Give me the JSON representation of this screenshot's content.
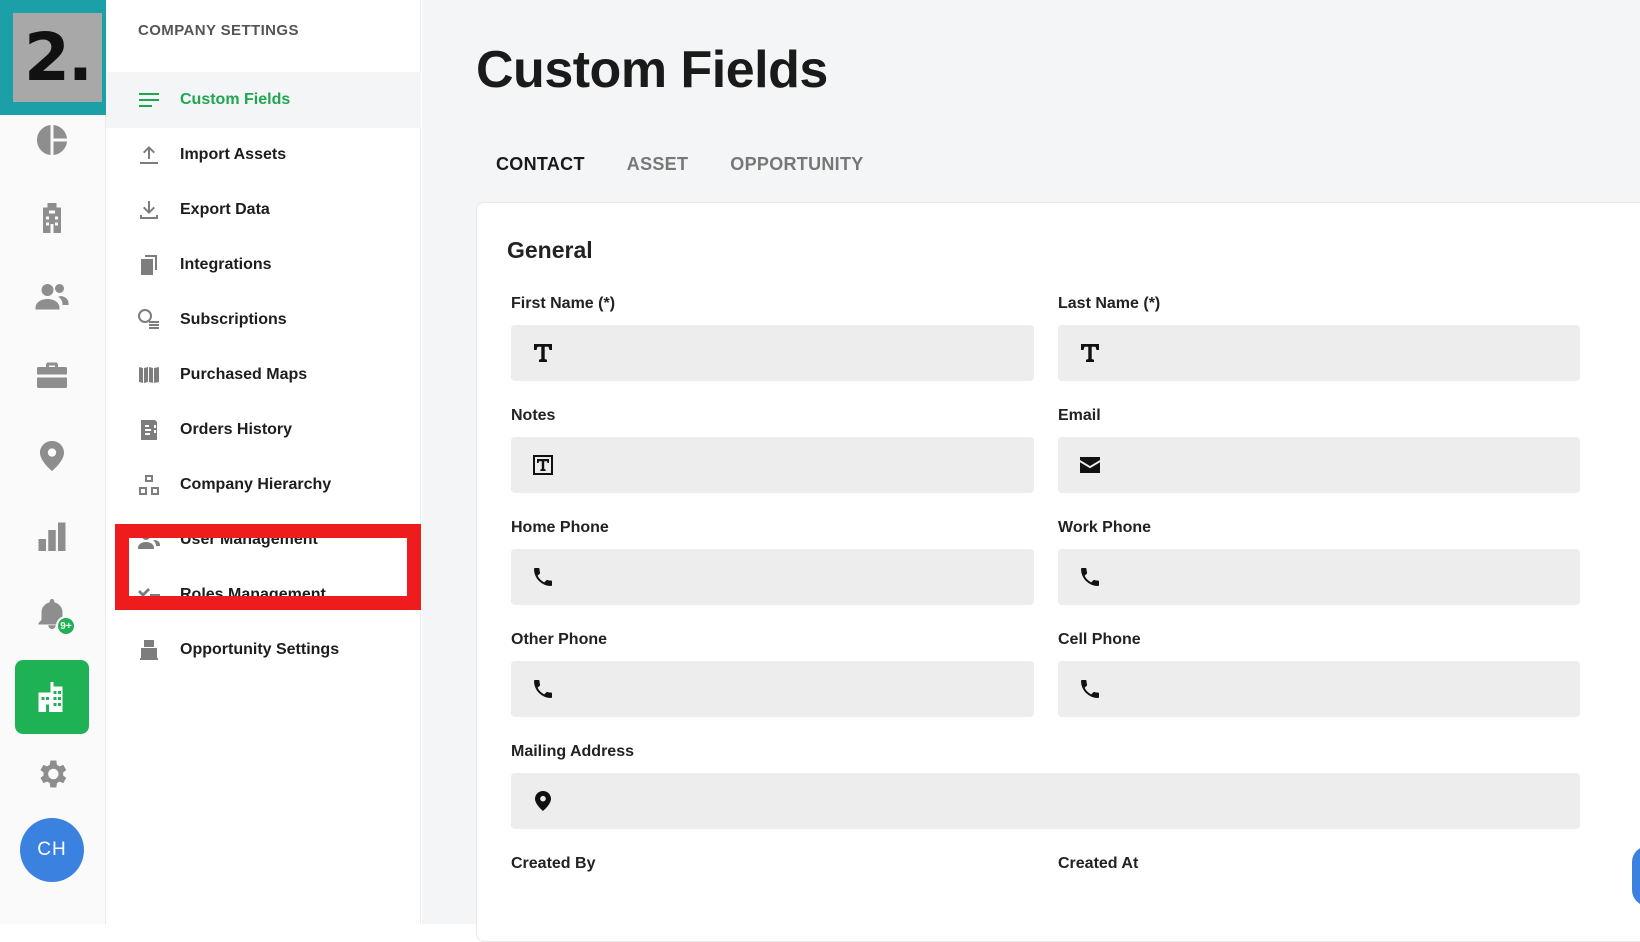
{
  "step_badge": "2.",
  "rail": {
    "icons": [
      "pie-chart-icon",
      "building-icon",
      "contacts-icon",
      "briefcase-icon",
      "location-pin-icon",
      "bar-chart-icon",
      "bell-icon",
      "company-icon",
      "gear-icon"
    ],
    "notification_count": "9+",
    "avatar_initials": "CH",
    "accent_color": "#1fb255"
  },
  "settings": {
    "header": "COMPANY SETTINGS",
    "items": [
      {
        "label": "Custom Fields",
        "icon": "lines-icon",
        "active": true
      },
      {
        "label": "Import Assets",
        "icon": "upload-icon"
      },
      {
        "label": "Export Data",
        "icon": "download-icon"
      },
      {
        "label": "Integrations",
        "icon": "integrations-icon"
      },
      {
        "label": "Subscriptions",
        "icon": "coins-icon"
      },
      {
        "label": "Purchased Maps",
        "icon": "maps-icon"
      },
      {
        "label": "Orders History",
        "icon": "orders-icon"
      },
      {
        "label": "Company Hierarchy",
        "icon": "hierarchy-icon"
      },
      {
        "label": "User Management",
        "icon": "users-icon",
        "highlighted": true
      },
      {
        "label": "Roles Management",
        "icon": "roles-icon"
      },
      {
        "label": "Opportunity Settings",
        "icon": "opportunity-icon"
      }
    ]
  },
  "main": {
    "title": "Custom Fields",
    "tabs": [
      {
        "label": "CONTACT",
        "active": true
      },
      {
        "label": "ASSET"
      },
      {
        "label": "OPPORTUNITY"
      }
    ],
    "section_title": "General",
    "fields": {
      "first_name": {
        "label": "First Name (*)",
        "icon": "text-icon"
      },
      "last_name": {
        "label": "Last Name (*)",
        "icon": "text-icon"
      },
      "notes": {
        "label": "Notes",
        "icon": "textbox-icon"
      },
      "email": {
        "label": "Email",
        "icon": "envelope-icon"
      },
      "home_phone": {
        "label": "Home Phone",
        "icon": "phone-icon"
      },
      "work_phone": {
        "label": "Work Phone",
        "icon": "phone-icon"
      },
      "other_phone": {
        "label": "Other Phone",
        "icon": "phone-icon"
      },
      "cell_phone": {
        "label": "Cell Phone",
        "icon": "phone-icon"
      },
      "mailing_address": {
        "label": "Mailing Address",
        "icon": "location-pin-icon"
      },
      "created_by": {
        "label": "Created By"
      },
      "created_at": {
        "label": "Created At"
      }
    }
  },
  "colors": {
    "highlight": "#ee1c1c",
    "active_green": "#1fa650",
    "badge_teal": "#1aa0a6"
  }
}
